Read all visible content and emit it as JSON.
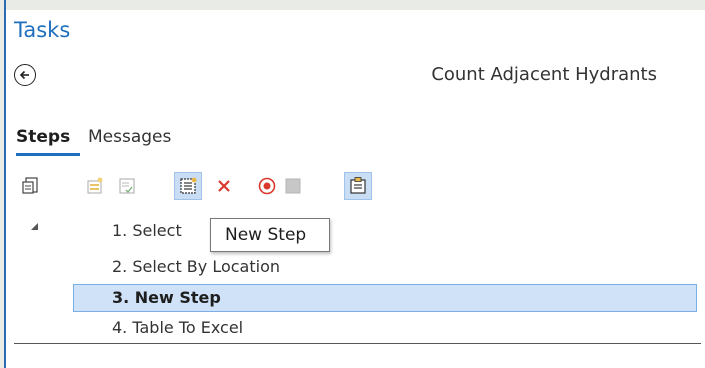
{
  "pane": {
    "title": "Tasks"
  },
  "task": {
    "name": "Count Adjacent Hydrants"
  },
  "tabs": [
    {
      "label": "Steps",
      "active": true
    },
    {
      "label": "Messages",
      "active": false
    }
  ],
  "toolbar": {
    "buttons": [
      {
        "icon": "task-document-icon"
      },
      {
        "icon": "new-task-item-icon"
      },
      {
        "icon": "edit-step-icon"
      },
      {
        "icon": "new-step-icon",
        "selected": true
      },
      {
        "icon": "delete-icon"
      },
      {
        "icon": "record-icon"
      },
      {
        "icon": "stop-icon"
      },
      {
        "icon": "insert-step-icon",
        "selected": true
      }
    ]
  },
  "steps": [
    {
      "label": "1.  Select By Attribute",
      "visible_label": "1.  Select",
      "suffix": "e"
    },
    {
      "label": "2.  Select By Location"
    },
    {
      "label": "3.  New Step",
      "selected": true
    },
    {
      "label": "4.  Table To Excel"
    }
  ],
  "tooltip": {
    "text": "New Step"
  },
  "colors": {
    "accent": "#1f6fbf",
    "selection_bg": "#cfe2f7",
    "selection_border": "#7aaee5",
    "delete_red": "#d9382c",
    "record_red": "#d9382c"
  }
}
